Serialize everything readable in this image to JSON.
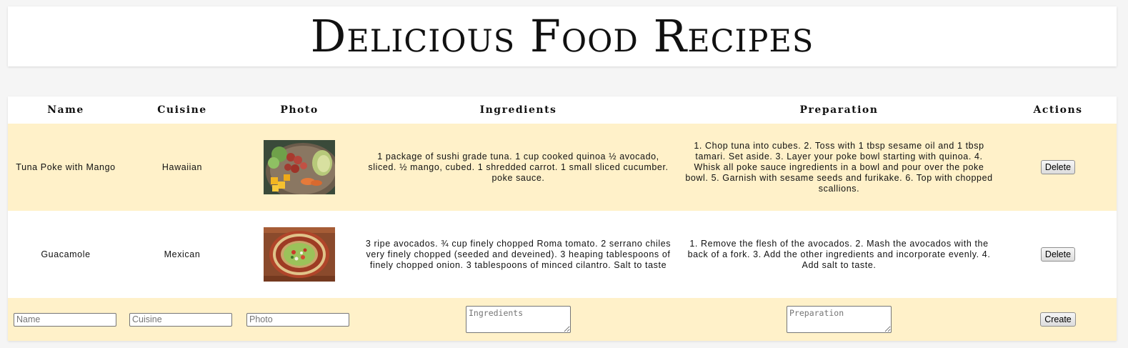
{
  "page": {
    "title": "Delicious Food Recipes"
  },
  "table": {
    "headers": [
      "Name",
      "Cuisine",
      "Photo",
      "Ingredients",
      "Preparation",
      "Actions"
    ],
    "rows": [
      {
        "name": "Tuna Poke with Mango",
        "cuisine": "Hawaiian",
        "photo_alt": "Tuna poke bowl with mango and avocado",
        "ingredients": "1 package of sushi grade tuna. 1 cup cooked quinoa ½ avocado, sliced. ½ mango, cubed. 1 shredded carrot. 1 small sliced cucumber. poke sauce.",
        "preparation": "1. Chop tuna into cubes. 2. Toss with 1 tbsp sesame oil and 1 tbsp tamari. Set aside. 3. Layer your poke bowl starting with quinoa. 4. Whisk all poke sauce ingredients in a bowl and pour over the poke bowl. 5. Garnish with sesame seeds and furikake. 6. Top with chopped scallions.",
        "action_label": "Delete"
      },
      {
        "name": "Guacamole",
        "cuisine": "Mexican",
        "photo_alt": "Guacamole on a decorated plate",
        "ingredients": "3 ripe avocados. ¾ cup finely chopped Roma tomato. 2 serrano chiles very finely chopped (seeded and deveined). 3 heaping tablespoons of finely chopped onion. 3 tablespoons of minced cilantro. Salt to taste",
        "preparation": "1. Remove the flesh of the avocados. 2. Mash the avocados with the back of a fork. 3. Add the other ingredients and incorporate evenly. 4. Add salt to taste.",
        "action_label": "Delete"
      }
    ]
  },
  "form": {
    "name_placeholder": "Name",
    "cuisine_placeholder": "Cuisine",
    "photo_placeholder": "Photo",
    "ingredients_placeholder": "Ingredients",
    "preparation_placeholder": "Preparation",
    "create_label": "Create"
  },
  "colors": {
    "row_highlight": "#fff1c9",
    "header_bg": "#ffffff",
    "page_bg": "#f5f5f5"
  }
}
